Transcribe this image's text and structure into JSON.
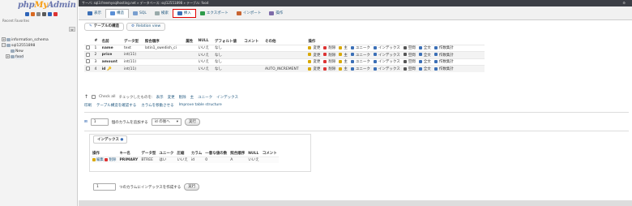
{
  "sidebar": {
    "logo_php": "php",
    "logo_my": "My",
    "logo_admin": "Admin",
    "icon_colors": [
      "#2e64b8",
      "#d96a22",
      "#888888",
      "#5a5a5a",
      "#2e64b8",
      "#d33"
    ],
    "recent_favorites": "Recent  Favorites",
    "collapse_label": "⇔",
    "tree": [
      {
        "label": "information_schema",
        "indent": 0,
        "exp": "+"
      },
      {
        "label": "sql12551898",
        "indent": 0,
        "exp": "−"
      },
      {
        "label": "New",
        "indent": 1,
        "exp": ""
      },
      {
        "label": "food",
        "indent": 1,
        "exp": "+"
      }
    ]
  },
  "topbar": {
    "breadcrumb": "サーバ: sql3.freemysqlhosting.net » データベース: sql12551898 » テーブル: food",
    "gear": "⚙"
  },
  "tabs": [
    {
      "label": "表示",
      "color": "#3b6fb6",
      "active": false,
      "hl": false
    },
    {
      "label": "構造",
      "color": "#5a8fd6",
      "active": true,
      "hl": false
    },
    {
      "label": "SQL",
      "color": "#7a9fcf",
      "active": false,
      "hl": false
    },
    {
      "label": "検索",
      "color": "#9aa",
      "active": false,
      "hl": false
    },
    {
      "label": "挿入",
      "color": "#3b6fb6",
      "active": false,
      "hl": true
    },
    {
      "label": "エクスポート",
      "color": "#2e9b4a",
      "active": false,
      "hl": false
    },
    {
      "label": "インポート",
      "color": "#c86432",
      "active": false,
      "hl": false
    },
    {
      "label": "操作",
      "color": "#7d6ba8",
      "active": false,
      "hl": false
    }
  ],
  "subtabs": [
    {
      "label": "テーブルの構造",
      "active": true
    },
    {
      "label": "Relation view",
      "active": false
    }
  ],
  "structure": {
    "headers": [
      "#",
      "名前",
      "データ型",
      "照合順序",
      "属性",
      "NULL",
      "デフォルト値",
      "コメント",
      "その他",
      "操作"
    ],
    "rows": [
      {
        "num": "1",
        "name": "name",
        "key": false,
        "type": "text",
        "collation": "latin1_swedish_ci",
        "attr": "",
        "null": "いいえ",
        "default": "なし",
        "comment": "",
        "extra": ""
      },
      {
        "num": "2",
        "name": "price",
        "key": false,
        "type": "int(11)",
        "collation": "",
        "attr": "",
        "null": "いいえ",
        "default": "なし",
        "comment": "",
        "extra": ""
      },
      {
        "num": "3",
        "name": "amount",
        "key": false,
        "type": "int(11)",
        "collation": "",
        "attr": "",
        "null": "いいえ",
        "default": "なし",
        "comment": "",
        "extra": ""
      },
      {
        "num": "4",
        "name": "id",
        "key": true,
        "type": "int(11)",
        "collation": "",
        "attr": "",
        "null": "いいえ",
        "default": "なし",
        "comment": "",
        "extra": "AUTO_INCREMENT"
      }
    ],
    "actions": [
      {
        "label": "変更",
        "color": "#d9a800"
      },
      {
        "label": "削除",
        "color": "#d33"
      },
      {
        "label": "主",
        "color": "#d9a800"
      },
      {
        "label": "ユニーク",
        "color": "#3b6fb6"
      },
      {
        "label": "インデックス",
        "color": "#3b6fb6"
      },
      {
        "label": "空間",
        "color": "#555"
      },
      {
        "label": "全文",
        "color": "#3b6fb6"
      },
      {
        "label": "作数集計",
        "color": "#3b6fb6"
      }
    ]
  },
  "bulk": {
    "check_all": "Check all",
    "with_selected": "チェックしたものを:",
    "actions": [
      "表示",
      "変更",
      "削除",
      "主",
      "ユニーク",
      "インデックス"
    ]
  },
  "toolrow": [
    "印刷",
    "テーブル構造を確認する",
    "カラムを移動させる",
    "Improve table structure"
  ],
  "add_column": {
    "count": "1",
    "label": "個のカラムを追加する",
    "position": "id の後へ",
    "button": "実行"
  },
  "indexes": {
    "title": "インデックス",
    "headers": [
      "操作",
      "キー名",
      "データ型",
      "ユニーク",
      "圧縮",
      "カラム",
      "一意な値の数",
      "照合順序",
      "NULL",
      "コメント"
    ],
    "row": {
      "edit": "編集",
      "delete": "削除",
      "keyname": "PRIMARY",
      "type": "BTREE",
      "unique": "はい",
      "packed": "いいえ",
      "column": "id",
      "cardinality": "0",
      "collation": "A",
      "null": "いいえ",
      "comment": ""
    }
  },
  "create_index": {
    "count": "1",
    "label": "つのカラムにインデックスを作成する",
    "button": "実行"
  }
}
